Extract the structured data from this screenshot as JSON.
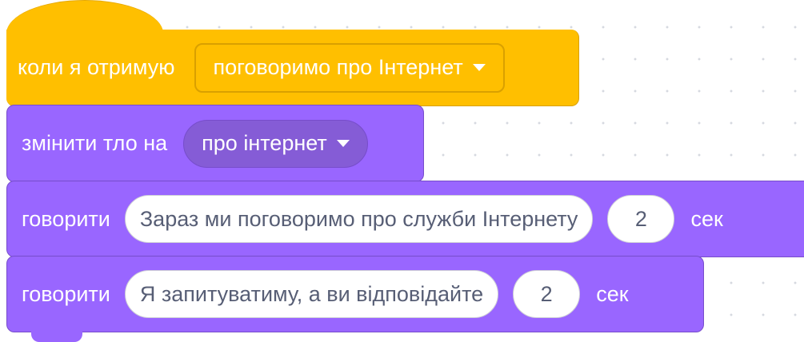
{
  "script": {
    "event_block": {
      "label": "коли я отримую",
      "message_dropdown": "поговоримо про Інтернет"
    },
    "switch_backdrop_block": {
      "label": "змінити тло на",
      "backdrop_dropdown": "про інтернет"
    },
    "say_blocks": [
      {
        "label": "говорити",
        "message": "Зараз ми поговоримо про служби Інтернету",
        "seconds": "2",
        "unit": "сек"
      },
      {
        "label": "говорити",
        "message": "Я запитуватиму, а ви відповідайте",
        "seconds": "2",
        "unit": "сек"
      }
    ]
  },
  "colors": {
    "events": "#FFBF00",
    "looks": "#9966FF",
    "looks_dropdown": "#855CD6",
    "input_text": "#575e75",
    "background": "#ffffff"
  },
  "icons": {
    "dropdown_caret": "caret-down-icon"
  }
}
